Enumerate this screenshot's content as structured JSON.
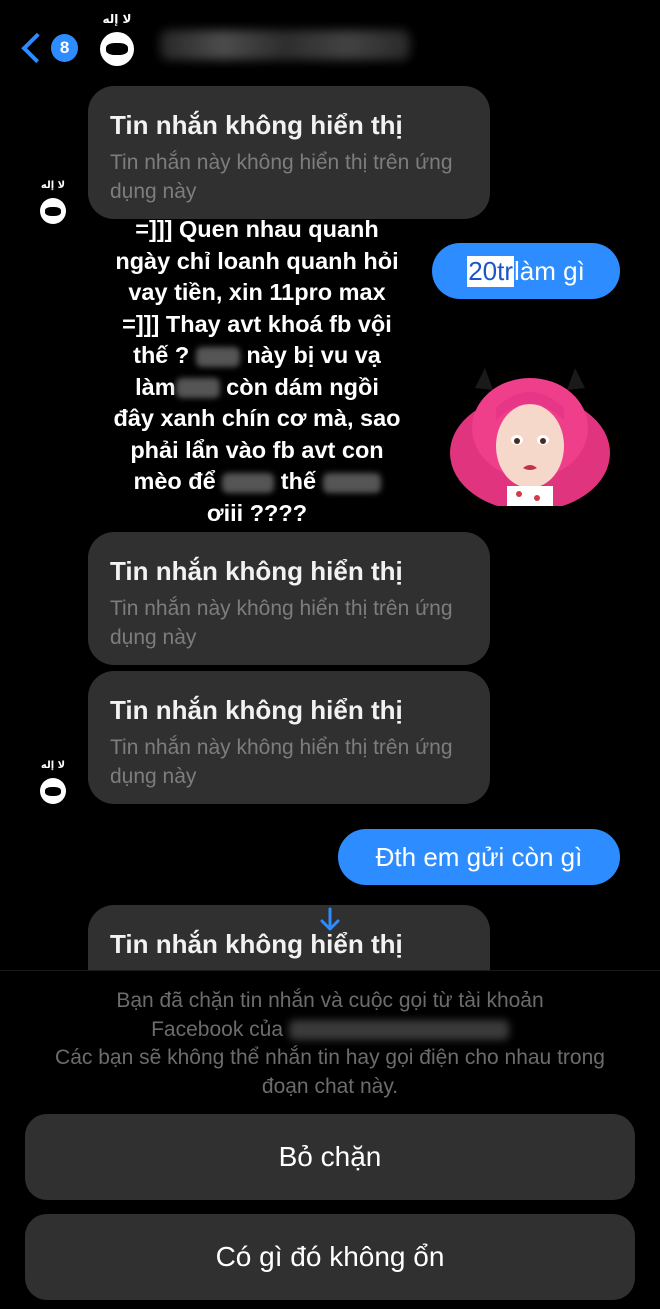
{
  "header": {
    "back_badge": "8",
    "avatar_glyphs": "لا إله"
  },
  "messages": {
    "hidden_title": "Tin nhắn không hiển thị",
    "hidden_sub": "Tin nhắn này không hiển thị trên ứng dụng này",
    "incoming_lines": [
      "=]]] Quen nhau quanh",
      "ngày chỉ loanh quanh hỏi",
      "vay tiền, xin 11pro max",
      "=]]] Thay avt khoá fb vội",
      "thế ?",
      "này bị vu vạ",
      "làm",
      "còn dám ngồi",
      "đây xanh chín cơ mà, sao",
      "phải lẩn vào fb avt con",
      "mèo để",
      "thế",
      "ơiii ????"
    ],
    "sent1_highlight": "20tr",
    "sent1_rest": " làm gì",
    "sent2": "Đth em gửi còn gì"
  },
  "footer": {
    "notice_part1": "Bạn đã chặn tin nhắn và cuộc gọi từ tài khoản",
    "notice_part2": "Facebook của",
    "notice_part3": "Các bạn sẽ không thể nhắn tin hay gọi điện cho nhau trong đoạn chat này.",
    "unblock_label": "Bỏ chặn",
    "report_label": "Có gì đó không ổn"
  },
  "colors": {
    "accent": "#2d8cff",
    "bubble_gray": "#303030",
    "background": "#000000"
  }
}
